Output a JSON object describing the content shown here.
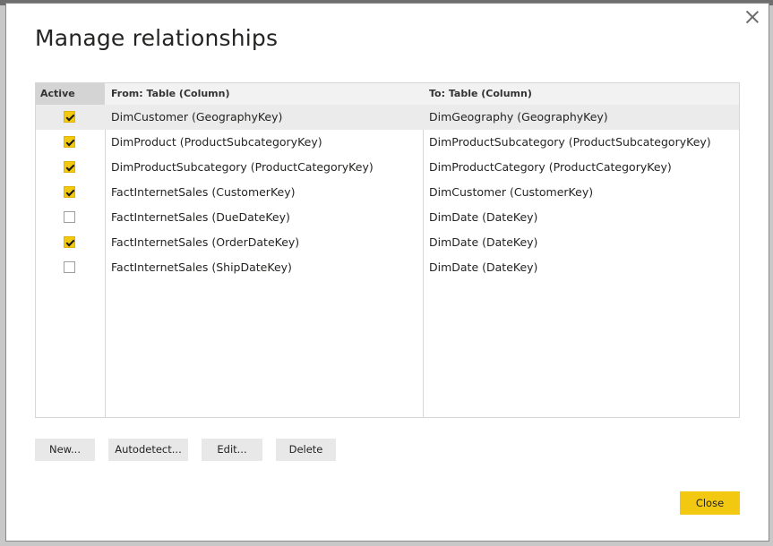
{
  "dialog": {
    "title": "Manage relationships",
    "close_icon": "close-icon"
  },
  "table": {
    "headers": {
      "active": "Active",
      "from": "From: Table (Column)",
      "to": "To: Table (Column)"
    },
    "rows": [
      {
        "active": true,
        "from": "DimCustomer (GeographyKey)",
        "to": "DimGeography (GeographyKey)",
        "selected": true
      },
      {
        "active": true,
        "from": "DimProduct (ProductSubcategoryKey)",
        "to": "DimProductSubcategory (ProductSubcategoryKey)",
        "selected": false
      },
      {
        "active": true,
        "from": "DimProductSubcategory (ProductCategoryKey)",
        "to": "DimProductCategory (ProductCategoryKey)",
        "selected": false
      },
      {
        "active": true,
        "from": "FactInternetSales (CustomerKey)",
        "to": "DimCustomer (CustomerKey)",
        "selected": false
      },
      {
        "active": false,
        "from": "FactInternetSales (DueDateKey)",
        "to": "DimDate (DateKey)",
        "selected": false
      },
      {
        "active": true,
        "from": "FactInternetSales (OrderDateKey)",
        "to": "DimDate (DateKey)",
        "selected": false
      },
      {
        "active": false,
        "from": "FactInternetSales (ShipDateKey)",
        "to": "DimDate (DateKey)",
        "selected": false
      }
    ]
  },
  "buttons": {
    "new": "New...",
    "autodetect": "Autodetect...",
    "edit": "Edit...",
    "delete": "Delete",
    "close": "Close"
  },
  "colors": {
    "accent": "#F2C811",
    "selected_row": "#EBEBEB",
    "header_bg": "#F2F2F2"
  }
}
